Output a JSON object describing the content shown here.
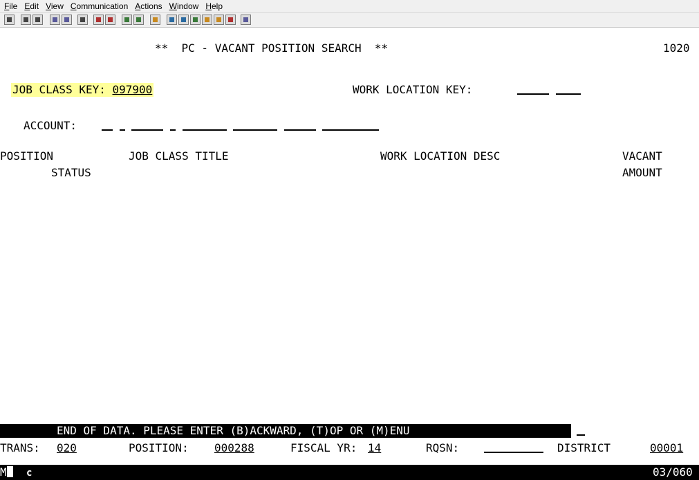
{
  "menu": {
    "items": [
      {
        "key": "F",
        "rest": "ile"
      },
      {
        "key": "E",
        "rest": "dit"
      },
      {
        "key": "V",
        "rest": "iew"
      },
      {
        "key": "C",
        "rest": "ommunication"
      },
      {
        "key": "A",
        "rest": "ctions"
      },
      {
        "key": "W",
        "rest": "indow"
      },
      {
        "key": "H",
        "rest": "elp"
      }
    ]
  },
  "screen": {
    "title": "**  PC - VACANT POSITION SEARCH  **",
    "screen_id": "1020",
    "job_class_key_label": "JOB CLASS KEY:",
    "job_class_key_value": "097900",
    "work_location_key_label": "WORK LOCATION KEY:",
    "account_label": "ACCOUNT:",
    "columns": {
      "position": "POSITION",
      "status": "STATUS",
      "job_class_title": "JOB CLASS TITLE",
      "work_location_desc": "WORK LOCATION DESC",
      "vacant": "VACANT",
      "amount": "AMOUNT"
    },
    "message": "END OF DATA. PLEASE ENTER (B)ACKWARD, (T)OP OR (M)ENU",
    "footer": {
      "trans_label": "TRANS:",
      "trans_value": "020",
      "position_label": "POSITION:",
      "position_value": "000288",
      "fiscal_label": "FISCAL YR:",
      "fiscal_value": "14",
      "rqsn_label": "RQSN:",
      "district_label": "DISTRICT",
      "district_value": "00001"
    },
    "status_bar": {
      "mode_prefix": "M",
      "indicator": "c",
      "cursor_pos": "03/060"
    }
  }
}
